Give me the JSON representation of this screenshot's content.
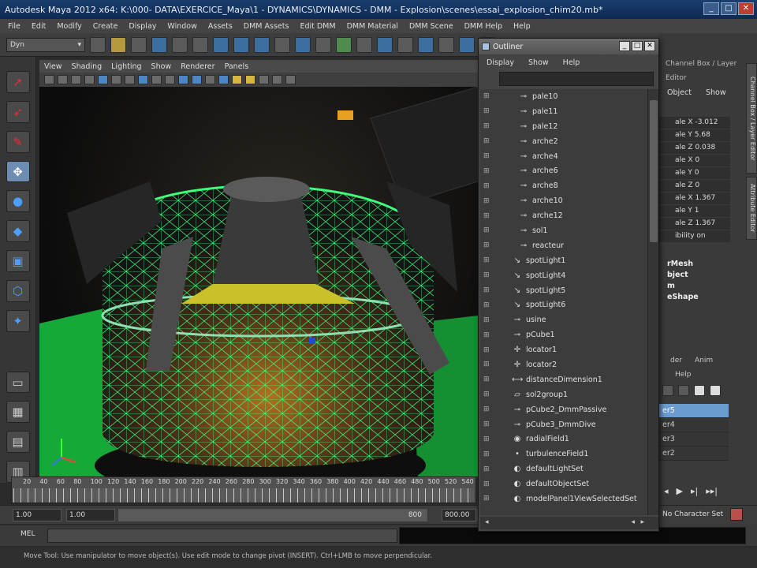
{
  "window": {
    "title": "Autodesk Maya 2012 x64: K:\\000- DATA\\EXERCICE_Maya\\1 - DYNAMICS\\DYNAMICS - DMM - Explosion\\scenes\\essai_explosion_chim20.mb*",
    "minimize": "_",
    "maximize": "□",
    "close": "✕"
  },
  "menubar": [
    "File",
    "Edit",
    "Modify",
    "Create",
    "Display",
    "Window",
    "Assets",
    "DMM Assets",
    "Edit DMM",
    "DMM Material",
    "DMM Scene",
    "DMM Help",
    "Help"
  ],
  "shelf": {
    "mode_selector": "Dyn"
  },
  "viewport_menu": [
    "View",
    "Shading",
    "Lighting",
    "Show",
    "Renderer",
    "Panels"
  ],
  "channel_box": {
    "header": "Channel Box / Layer Editor",
    "tabs": [
      "Object",
      "Show"
    ],
    "attributes": [
      "ale X  -3.012",
      "ale Y  5.68",
      "ale Z  0.038",
      "ale X  0",
      "ale Y  0",
      "ale Z  0",
      "ale X  1.367",
      "ale Y  1",
      "ale Z  1.367",
      "ibility  on"
    ],
    "shapes": [
      "rMesh",
      "bject",
      "m",
      "eShape"
    ]
  },
  "layers": {
    "tabs": [
      "der",
      "Anim"
    ],
    "menu": "Help",
    "items": [
      "er5",
      "er4",
      "er3",
      "er2"
    ],
    "selected_index": 0
  },
  "vertical_tabs": [
    "Channel Box / Layer Editor",
    "Attribute Editor"
  ],
  "timeline": {
    "ticks": [
      "20",
      "40",
      "60",
      "80",
      "100",
      "120",
      "140",
      "160",
      "180",
      "200",
      "220",
      "240",
      "260",
      "280",
      "300",
      "320",
      "340",
      "360",
      "380",
      "400",
      "420",
      "440",
      "460",
      "480",
      "500",
      "520",
      "540"
    ]
  },
  "range": {
    "start": "1.00",
    "playback_start": "1.00",
    "playback_end": "800",
    "end": "800.00",
    "character_set": "No Character Set"
  },
  "command": {
    "label": "MEL"
  },
  "help_line": "Move Tool: Use manipulator to move object(s). Use edit mode to change pivot (INSERT). Ctrl+LMB to move perpendicular.",
  "outliner": {
    "title": "Outliner",
    "menu": [
      "Display",
      "Show",
      "Help"
    ],
    "items": [
      {
        "label": "pale10",
        "glyph": "⊸",
        "child": true
      },
      {
        "label": "pale11",
        "glyph": "⊸",
        "child": true
      },
      {
        "label": "pale12",
        "glyph": "⊸",
        "child": true
      },
      {
        "label": "arche2",
        "glyph": "⊸",
        "child": true
      },
      {
        "label": "arche4",
        "glyph": "⊸",
        "child": true
      },
      {
        "label": "arche6",
        "glyph": "⊸",
        "child": true
      },
      {
        "label": "arche8",
        "glyph": "⊸",
        "child": true
      },
      {
        "label": "arche10",
        "glyph": "⊸",
        "child": true
      },
      {
        "label": "arche12",
        "glyph": "⊸",
        "child": true
      },
      {
        "label": "sol1",
        "glyph": "⊸",
        "child": true
      },
      {
        "label": "reacteur",
        "glyph": "⊸",
        "child": true
      },
      {
        "label": "spotLight1",
        "glyph": "↘",
        "child": false
      },
      {
        "label": "spotLight4",
        "glyph": "↘",
        "child": false
      },
      {
        "label": "spotLight5",
        "glyph": "↘",
        "child": false
      },
      {
        "label": "spotLight6",
        "glyph": "↘",
        "child": false
      },
      {
        "label": "usine",
        "glyph": "⊸",
        "child": false
      },
      {
        "label": "pCube1",
        "glyph": "⊸",
        "child": false
      },
      {
        "label": "locator1",
        "glyph": "✛",
        "child": false
      },
      {
        "label": "locator2",
        "glyph": "✛",
        "child": false
      },
      {
        "label": "distanceDimension1",
        "glyph": "⟷",
        "child": false
      },
      {
        "label": "sol2group1",
        "glyph": "▱",
        "child": false
      },
      {
        "label": "pCube2_DmmPassive",
        "glyph": "⊸",
        "child": false
      },
      {
        "label": "pCube3_DmmDive",
        "glyph": "⊸",
        "child": false
      },
      {
        "label": "radialField1",
        "glyph": "◉",
        "child": false
      },
      {
        "label": "turbulenceField1",
        "glyph": "•",
        "child": false
      },
      {
        "label": "defaultLightSet",
        "glyph": "◐",
        "child": false
      },
      {
        "label": "defaultObjectSet",
        "glyph": "◐",
        "child": false
      },
      {
        "label": "modelPanel1ViewSelectedSet",
        "glyph": "◐",
        "child": false
      }
    ]
  },
  "colors": {
    "wireframe": "#3cff7a",
    "ground": "#17a83a",
    "selected_layer": "#6a9bd1"
  }
}
